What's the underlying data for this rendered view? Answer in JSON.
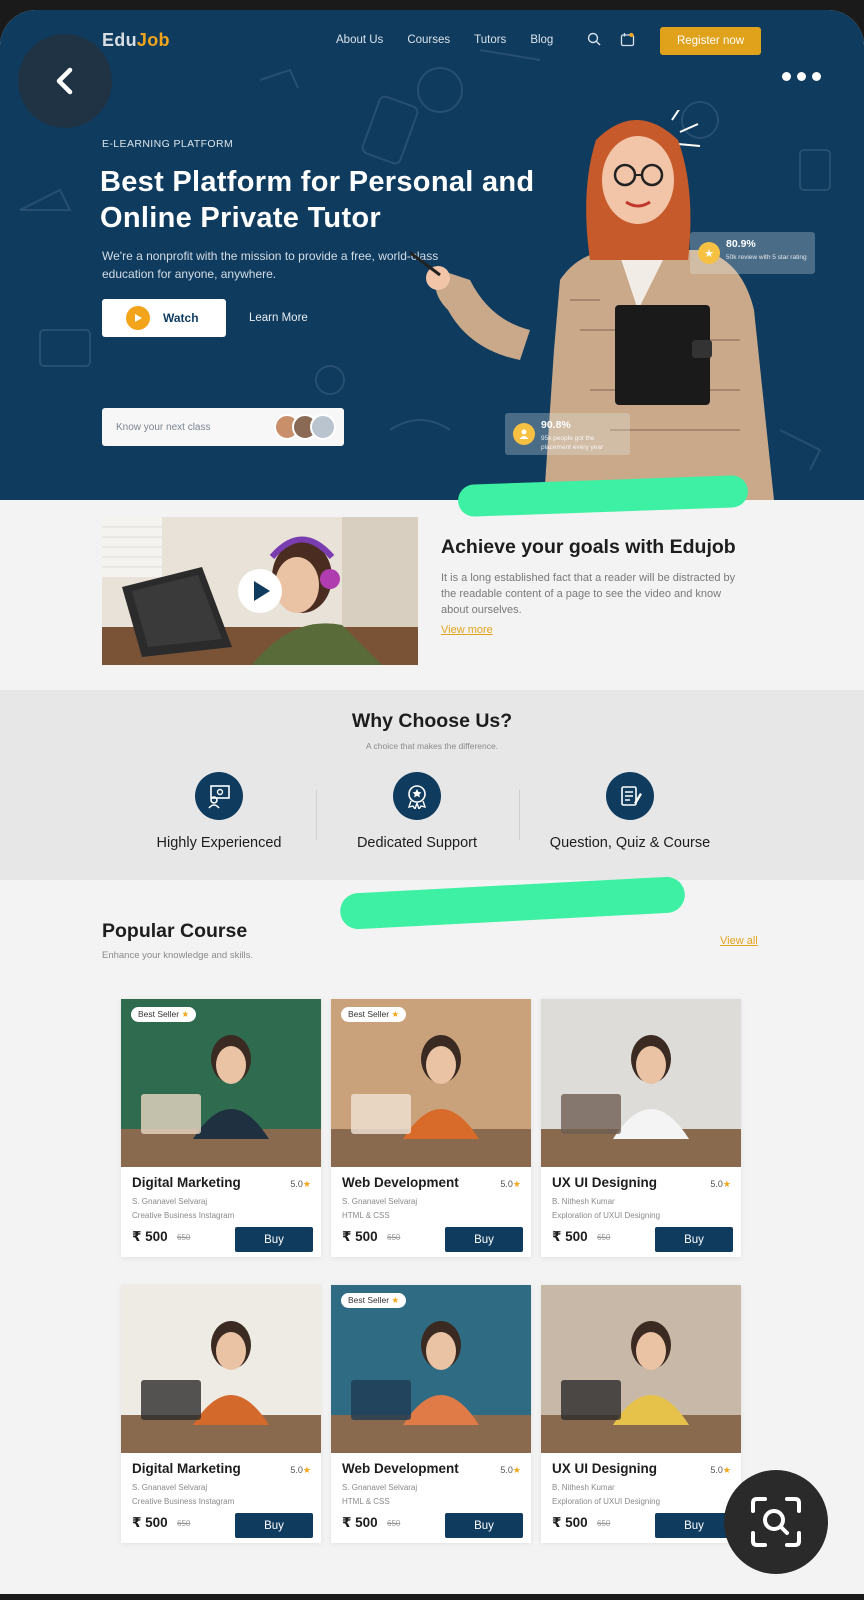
{
  "header": {
    "logo_part1": "Edu",
    "logo_part2": "Job",
    "nav": [
      "About Us",
      "Courses",
      "Tutors",
      "Blog"
    ],
    "register_label": "Register now"
  },
  "hero": {
    "eyebrow": "E-LEARNING PLATFORM",
    "headline": "Best Platform for Personal and Online Private Tutor",
    "subhead": "We're a nonprofit with the mission to provide a free, world-class education for anyone, anywhere.",
    "watch_label": "Watch",
    "learn_label": "Learn More",
    "next_class_placeholder": "Know your next class",
    "stat1_value": "80.9%",
    "stat1_desc": "50k review with 5 star rating",
    "stat2_value": "90.8%",
    "stat2_desc": "95k people got the placement every year"
  },
  "achieve": {
    "title": "Achieve your goals with Edujob",
    "text": "It is a long established fact that a reader will be distracted by the readable content of a page to see the video and know about ourselves.",
    "link": "View more"
  },
  "why": {
    "title": "Why Choose Us?",
    "subtitle": "A choice that makes the difference.",
    "features": [
      {
        "label": "Highly Experienced",
        "icon": "presentation-icon"
      },
      {
        "label": "Dedicated Support",
        "icon": "support-badge-icon"
      },
      {
        "label": "Question, Quiz & Course",
        "icon": "quiz-clipboard-icon"
      }
    ]
  },
  "courses": {
    "title": "Popular Course",
    "subtitle": "Enhance your knowledge and skills.",
    "view_all": "View all",
    "badge_text": "Best Seller",
    "star": "★",
    "buy_label": "Buy",
    "items": [
      {
        "title": "Digital Marketing",
        "rating": "5.0",
        "author": "S. Gnanavel Selvaraj",
        "tag": "Creative Business Instagram",
        "price": "₹ 500",
        "old": "650",
        "best": true
      },
      {
        "title": "Web Development",
        "rating": "5.0",
        "author": "S. Gnanavel Selvaraj",
        "tag": "HTML & CSS",
        "price": "₹ 500",
        "old": "650",
        "best": true
      },
      {
        "title": "UX UI Designing",
        "rating": "5.0",
        "author": "B. Nithesh Kumar",
        "tag": "Exploration of UXUI Designing",
        "price": "₹ 500",
        "old": "650",
        "best": false
      },
      {
        "title": "Digital Marketing",
        "rating": "5.0",
        "author": "S. Gnanavel Selvaraj",
        "tag": "Creative Business Instagram",
        "price": "₹ 500",
        "old": "650",
        "best": false
      },
      {
        "title": "Web Development",
        "rating": "5.0",
        "author": "S. Gnanavel Selvaraj",
        "tag": "HTML & CSS",
        "price": "₹ 500",
        "old": "650",
        "best": true
      },
      {
        "title": "UX UI Designing",
        "rating": "5.0",
        "author": "B. Nithesh Kumar",
        "tag": "Exploration of UXUI Designing",
        "price": "₹ 500",
        "old": "650",
        "best": false
      }
    ]
  },
  "colors": {
    "brand_navy": "#0f3b5f",
    "accent_orange": "#e0a21a",
    "highlight_mark": "#3ef0a3"
  }
}
